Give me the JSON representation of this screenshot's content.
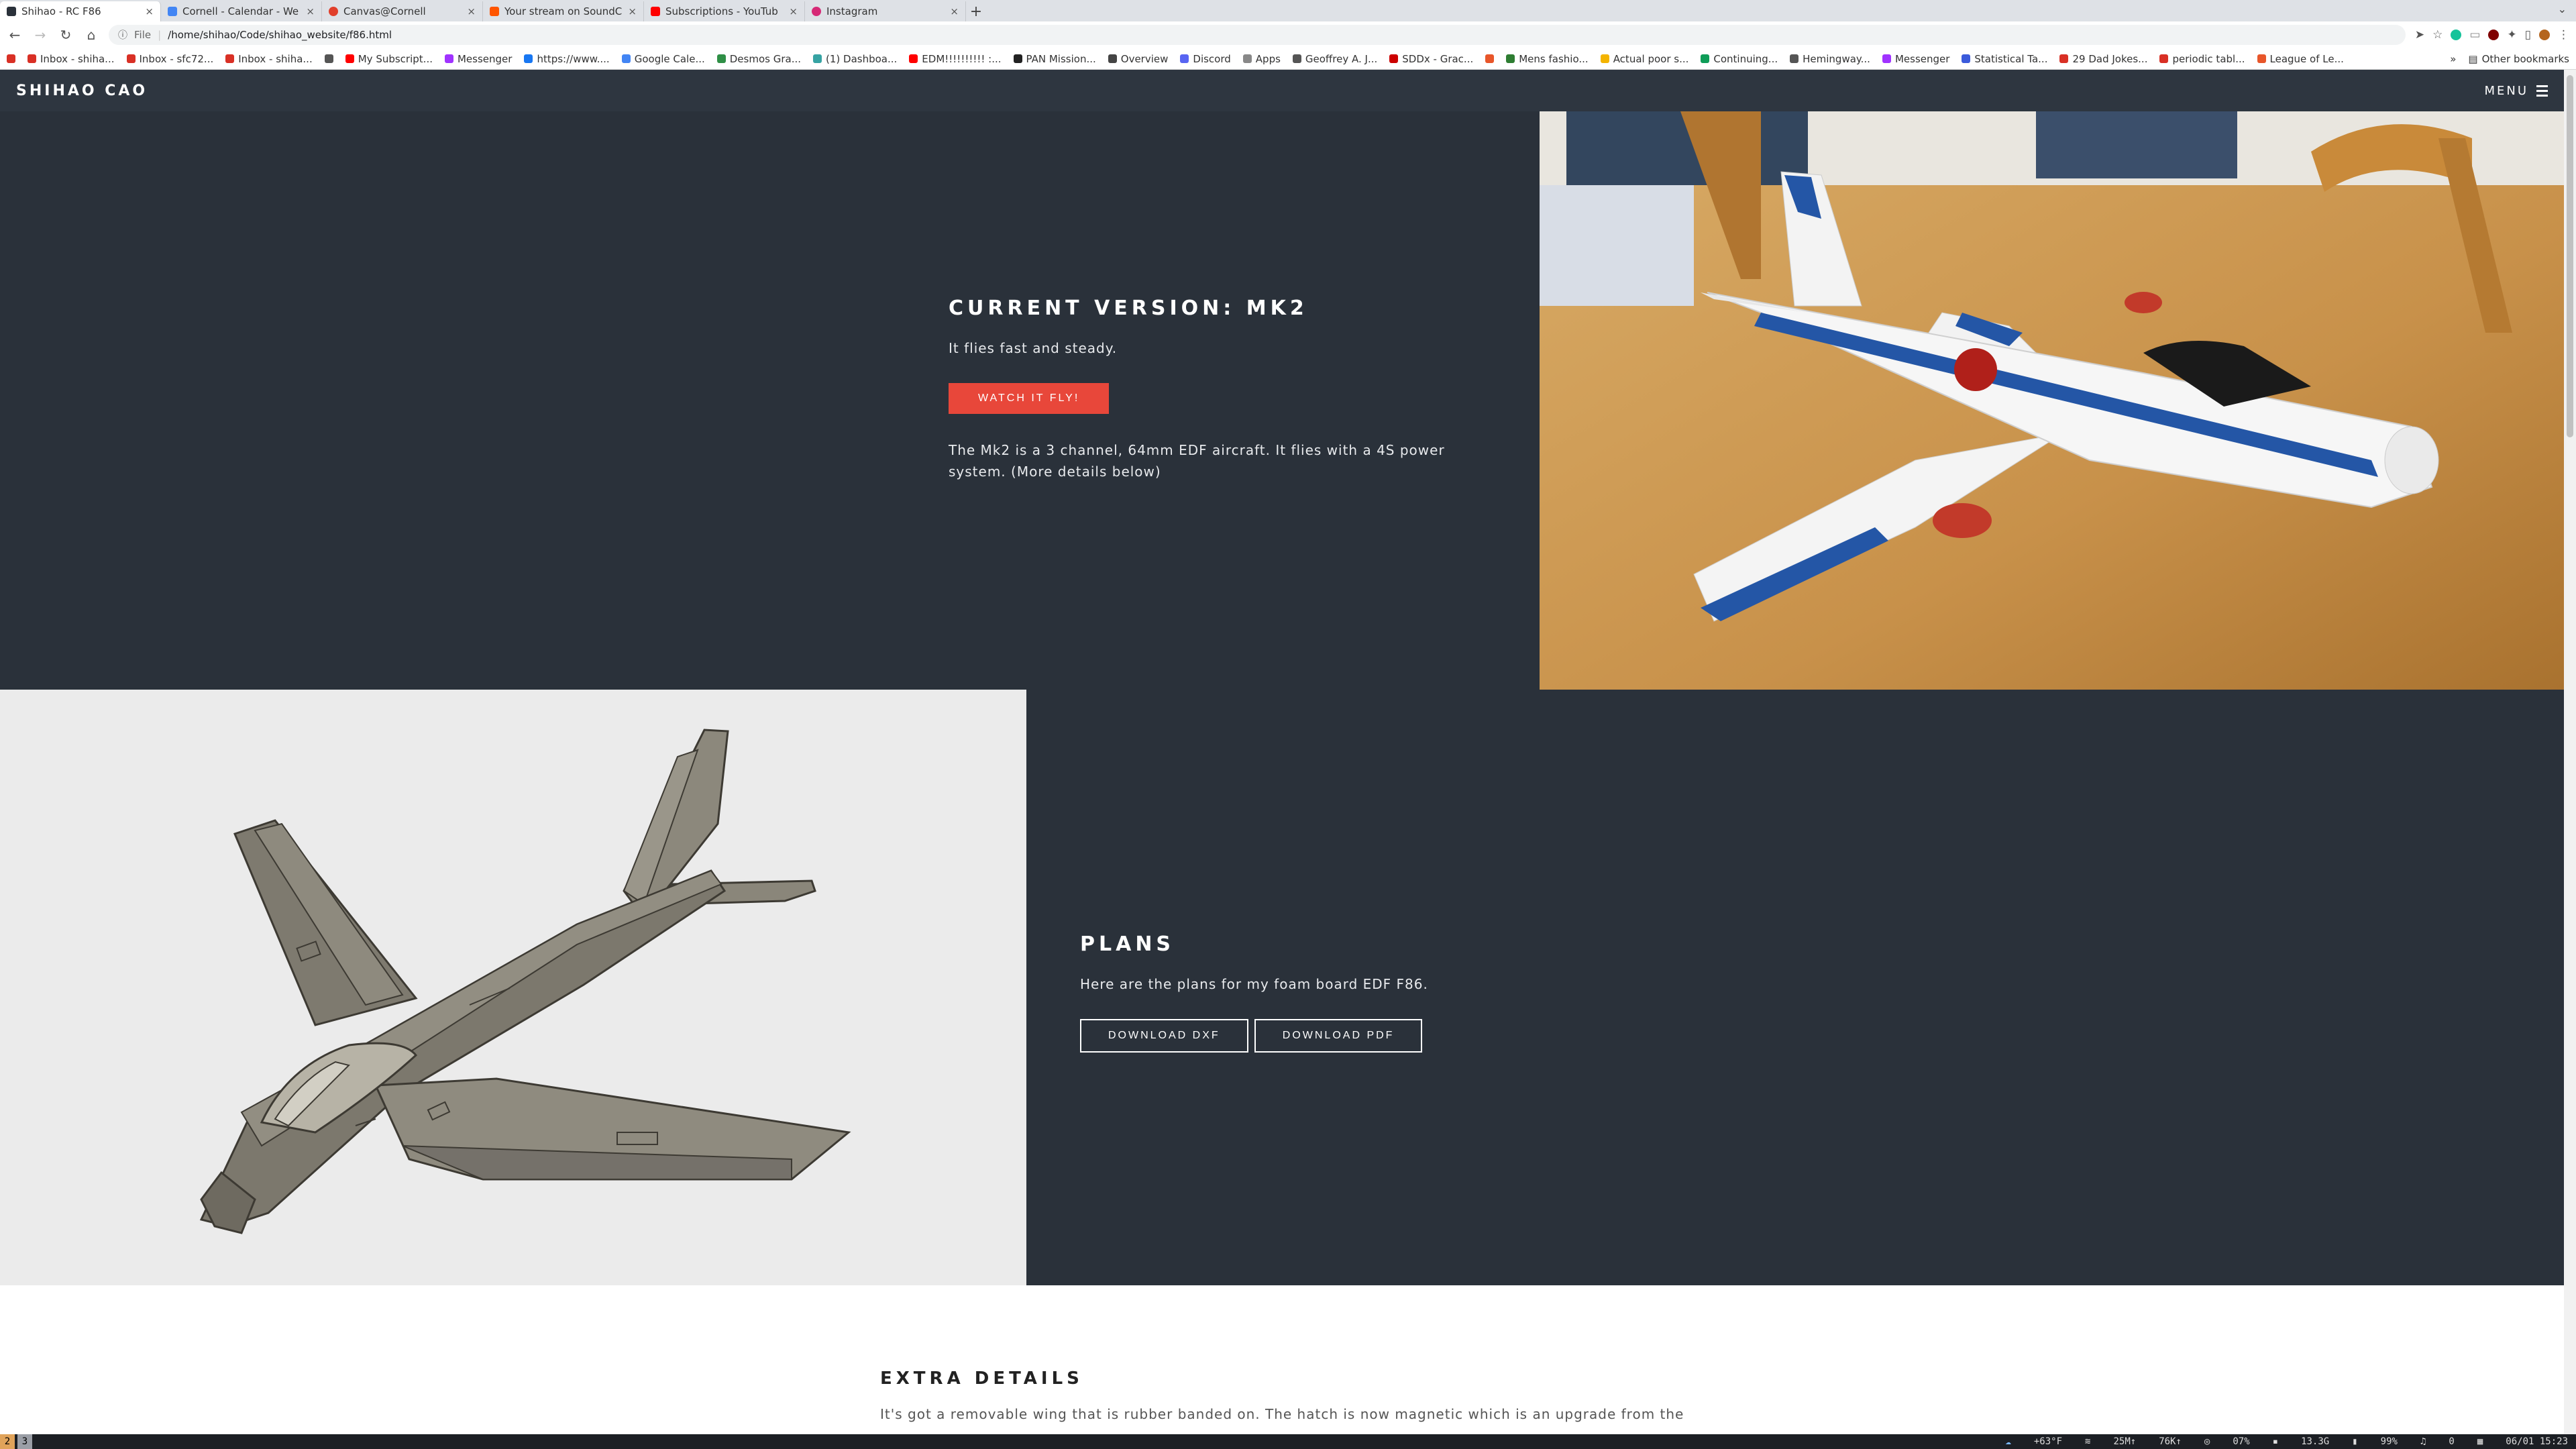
{
  "browser": {
    "tabs": [
      {
        "title": "Shihao - RC F86",
        "favicon_color": "#2a313a",
        "active": true
      },
      {
        "title": "Cornell - Calendar - We",
        "favicon_color": "#4285f4",
        "active": false
      },
      {
        "title": "Canvas@Cornell",
        "favicon_color": "#e13f2b",
        "active": false
      },
      {
        "title": "Your stream on SoundC",
        "favicon_color": "#ff5500",
        "active": false
      },
      {
        "title": "Subscriptions - YouTub",
        "favicon_color": "#ff0000",
        "active": false
      },
      {
        "title": "Instagram",
        "favicon_color": "#d62976",
        "active": false
      }
    ],
    "new_tab_label": "+",
    "address": {
      "scheme": "File",
      "url": "/home/shihao/Code/shihao_website/f86.html"
    },
    "bookmarks": [
      {
        "label": "Inbox - shiha...",
        "color": "#d93025"
      },
      {
        "label": "Inbox - sfc72...",
        "color": "#d93025"
      },
      {
        "label": "Inbox - shiha...",
        "color": "#d93025"
      },
      {
        "label": "",
        "color": "#555555"
      },
      {
        "label": "My Subscript...",
        "color": "#ff0000"
      },
      {
        "label": "Messenger",
        "color": "#a033ff"
      },
      {
        "label": "https://www....",
        "color": "#1877f2"
      },
      {
        "label": "Google Cale...",
        "color": "#4285f4"
      },
      {
        "label": "Desmos Gra...",
        "color": "#2f8f46"
      },
      {
        "label": "(1) Dashboa...",
        "color": "#36a3a3"
      },
      {
        "label": "EDM!!!!!!!!!! :...",
        "color": "#ff0000"
      },
      {
        "label": "PAN Mission...",
        "color": "#222222"
      },
      {
        "label": "Overview",
        "color": "#444444"
      },
      {
        "label": "Discord",
        "color": "#5865f2"
      },
      {
        "label": "Apps",
        "color": "#888888"
      },
      {
        "label": "Geoffrey A. J...",
        "color": "#555555"
      },
      {
        "label": "SDDx - Grac...",
        "color": "#cc0000"
      },
      {
        "label": "",
        "color": "#e8562a"
      },
      {
        "label": "Mens fashio...",
        "color": "#2e7d32"
      },
      {
        "label": "Actual poor s...",
        "color": "#f4b400"
      },
      {
        "label": "Continuing...",
        "color": "#0f9d58"
      },
      {
        "label": "Hemingway...",
        "color": "#555555"
      },
      {
        "label": "Messenger",
        "color": "#a033ff"
      },
      {
        "label": "Statistical Ta...",
        "color": "#3b5bdb"
      },
      {
        "label": "29 Dad Jokes...",
        "color": "#d93025"
      },
      {
        "label": "periodic tabl...",
        "color": "#d93025"
      },
      {
        "label": "League of Le...",
        "color": "#e8562a"
      }
    ],
    "bookmarks_more": "»",
    "other_bookmarks": "Other bookmarks"
  },
  "site": {
    "brand": "SHIHAO CAO",
    "menu_label": "MENU",
    "current": {
      "heading": "CURRENT VERSION: MK2",
      "tagline": "It flies fast and steady.",
      "watch_button": "WATCH IT FLY!",
      "description": "The Mk2 is a 3 channel, 64mm EDF aircraft. It flies with a 4S power system. (More details below)"
    },
    "plans": {
      "heading": "PLANS",
      "text": "Here are the plans for my foam board EDF F86.",
      "download_dxf": "DOWNLOAD DXF",
      "download_pdf": "DOWNLOAD PDF"
    },
    "extra": {
      "heading": "EXTRA DETAILS",
      "text": "It's got a removable wing that is rubber banded on. The hatch is now magnetic which is an upgrade from the"
    }
  },
  "taskbar": {
    "workspaces": [
      "2",
      "3"
    ],
    "weather": "+63°F",
    "wifi": "25M↑",
    "net": "76K↑",
    "cpu": "07%",
    "mem": "13.3G",
    "battery": "99%",
    "notifications": "0",
    "datetime": "06/01 15:23"
  },
  "colors": {
    "dark_section": "#2a313a",
    "header": "#2e3640",
    "accent_red": "#e8473a",
    "cad_background": "#ebebeb"
  }
}
